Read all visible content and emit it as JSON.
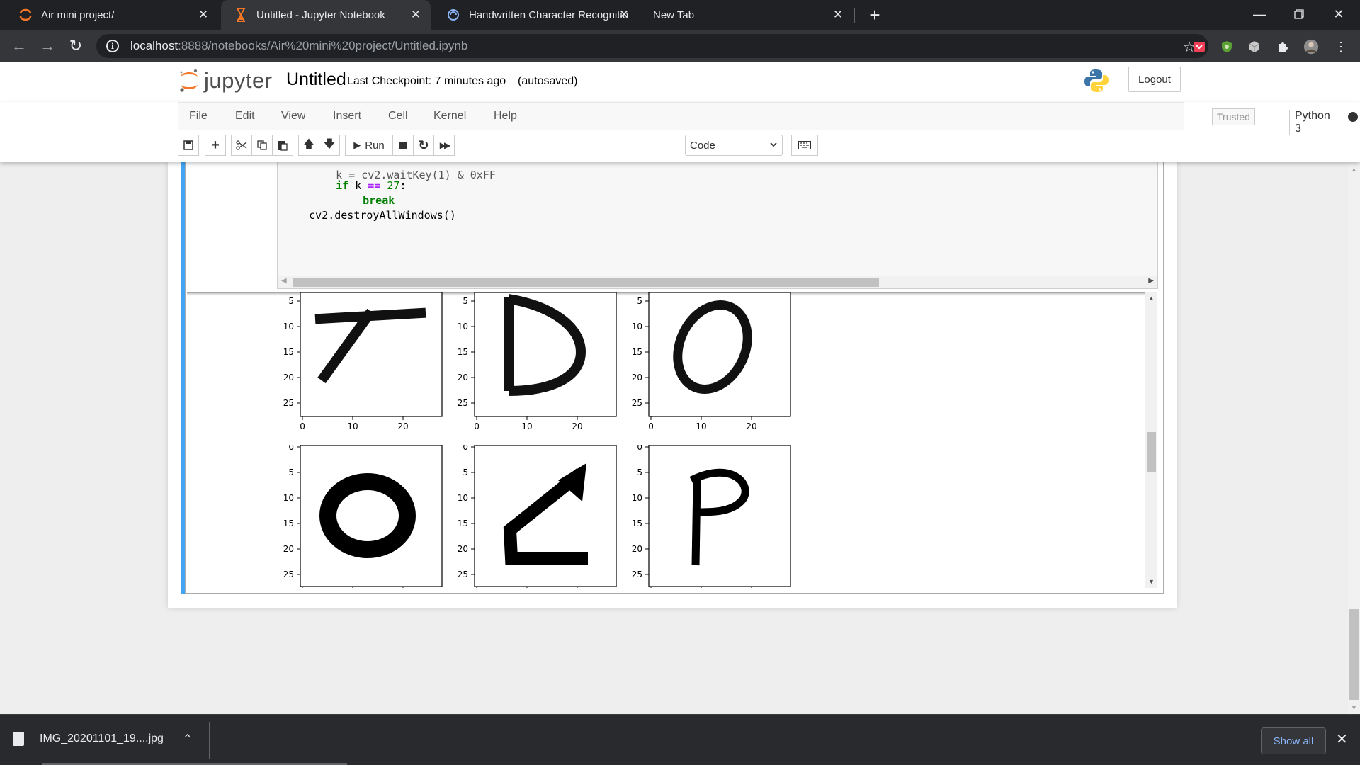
{
  "tabs": [
    {
      "title": "Air mini project/",
      "icon": "jupyter-spinner-icon"
    },
    {
      "title": "Untitled - Jupyter Notebook",
      "icon": "hourglass-icon"
    },
    {
      "title": "Handwritten Character Recognitio",
      "icon": "globe-spiral-icon"
    },
    {
      "title": "New Tab",
      "icon": ""
    }
  ],
  "browser": {
    "url_host": "localhost",
    "url_path": ":8888/notebooks/Air%20mini%20project/Untitled.ipynb"
  },
  "jupyter": {
    "logo_text": "jupyter",
    "notebook_name": "Untitled",
    "checkpoint": "Last Checkpoint: 7 minutes ago",
    "autosaved": "(autosaved)",
    "logout": "Logout",
    "menu": [
      "File",
      "Edit",
      "View",
      "Insert",
      "Cell",
      "Kernel",
      "Help"
    ],
    "trusted": "Trusted",
    "kernel": "Python 3",
    "run_label": "Run",
    "cell_type": "Code"
  },
  "code": {
    "line0": "k = cv2.waitKey(1) & 0xFF",
    "line1_kw": "if",
    "line1_a": " k ",
    "line1_op": "==",
    "line1_num": " 27",
    "line1_end": ":",
    "line2_kw": "break",
    "line3": "cv2.destroyAllWindows()"
  },
  "output": {
    "plots_row1": [
      "digit-T",
      "letter-D",
      "letter-O"
    ],
    "plots_row2": [
      "letter-O-bold",
      "letter-C-arrow",
      "letter-P"
    ],
    "y_ticks_row1": [
      "5",
      "10",
      "15",
      "20",
      "25"
    ],
    "y_ticks_row2": [
      "0",
      "5",
      "10",
      "15",
      "20",
      "25"
    ],
    "x_ticks": [
      "0",
      "10",
      "20"
    ]
  },
  "downloads": {
    "file": "IMG_20201101_19....jpg",
    "show_all": "Show all"
  }
}
